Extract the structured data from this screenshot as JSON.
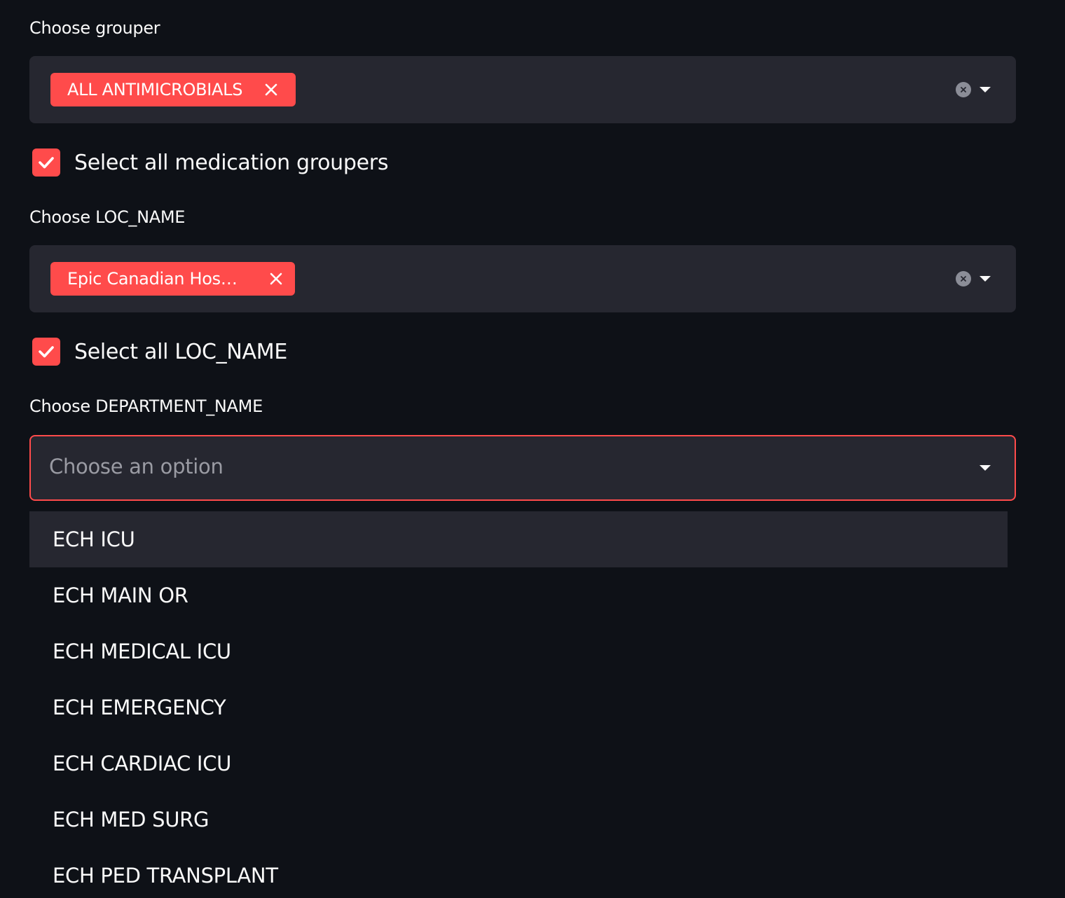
{
  "grouper": {
    "label": "Choose grouper",
    "selected_tag": "ALL ANTIMICROBIALS"
  },
  "select_all_groupers": {
    "label": "Select all medication groupers",
    "checked": true
  },
  "loc_name": {
    "label": "Choose LOC_NAME",
    "selected_tag": "Epic Canadian Hos…"
  },
  "select_all_loc": {
    "label": "Select all LOC_NAME",
    "checked": true
  },
  "department_name": {
    "label": "Choose DEPARTMENT_NAME",
    "placeholder": "Choose an option",
    "options": [
      "ECH ICU",
      "ECH MAIN OR",
      "ECH MEDICAL ICU",
      "ECH EMERGENCY",
      "ECH CARDIAC ICU",
      "ECH MED SURG",
      "ECH PED TRANSPLANT"
    ]
  },
  "colors": {
    "accent": "#ff4b4b",
    "background": "#0e1117",
    "input_background": "#262730",
    "text": "#fafafa",
    "placeholder": "#9a9ba3"
  },
  "icons": {
    "tag_remove": "close-icon",
    "clear": "clear-circle-icon",
    "dropdown": "caret-down-icon",
    "checkbox": "checkmark-icon"
  }
}
